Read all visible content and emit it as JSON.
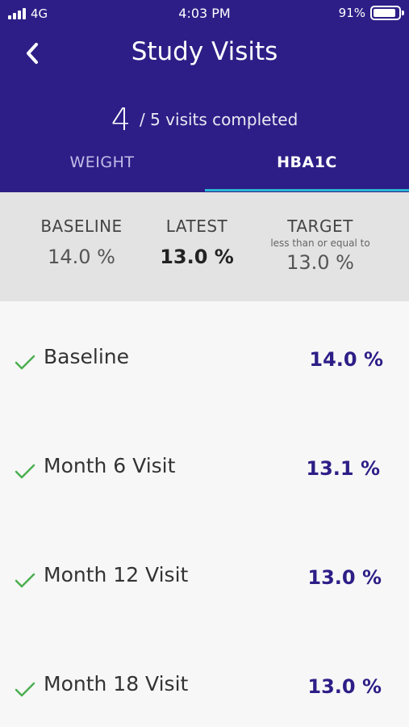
{
  "status_bar": {
    "carrier": "4G",
    "time": "4:03 PM",
    "battery": "91%",
    "battery_level": 0.91
  },
  "header": {
    "title": "Study Visits"
  },
  "progress": {
    "completed": "4",
    "label": "/ 5 visits completed"
  },
  "tabs": [
    {
      "label": "WEIGHT",
      "active": false
    },
    {
      "label": "HBA1C",
      "active": true
    }
  ],
  "summary": {
    "baseline": {
      "label": "BASELINE",
      "value": "14.0 %"
    },
    "latest": {
      "label": "LATEST",
      "value": "13.0 %"
    },
    "target": {
      "label": "TARGET",
      "sublabel": "less than or equal to",
      "value": "13.0 %"
    }
  },
  "visits": [
    {
      "name": "Baseline",
      "value": "14.0 %"
    },
    {
      "name": "Month 6 Visit",
      "value": "13.1 %"
    },
    {
      "name": "Month 12 Visit",
      "value": "13.0 %"
    },
    {
      "name": "Month 18 Visit",
      "value": "13.0 %"
    }
  ],
  "colors": {
    "header": "#2d1e87",
    "accent": "#29b6d4",
    "check": "#4caf50",
    "value_text": "#2d1e87"
  }
}
